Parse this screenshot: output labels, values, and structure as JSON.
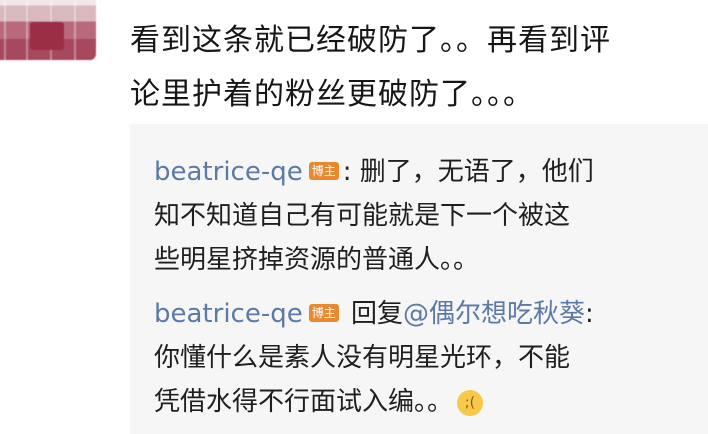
{
  "main_comment": {
    "line1": "看到这条就已经破防了。。再看到评",
    "line2": "论里护着的粉丝更破防了。。。"
  },
  "replies": [
    {
      "author": "beatrice-qe",
      "badge": "博主",
      "separator": ":",
      "line1": " 删了，无语了，他们",
      "line2": "知不知道自己有可能就是下一个被这",
      "line3": "些明星挤掉资源的普通人。。"
    },
    {
      "author": "beatrice-qe",
      "badge": "博主",
      "reply_word": " 回复",
      "mention": "@偶尔想吃秋葵",
      "separator": ":",
      "line2": "你懂什么是素人没有明星光环，不能",
      "line3": "凭借水得不行面试入编。。",
      "emoji": "crying-face-icon"
    }
  ],
  "colors": {
    "author_link": "#5c7aa3",
    "badge_bg": "#e9892f",
    "reply_bg": "#f6f6f6"
  }
}
